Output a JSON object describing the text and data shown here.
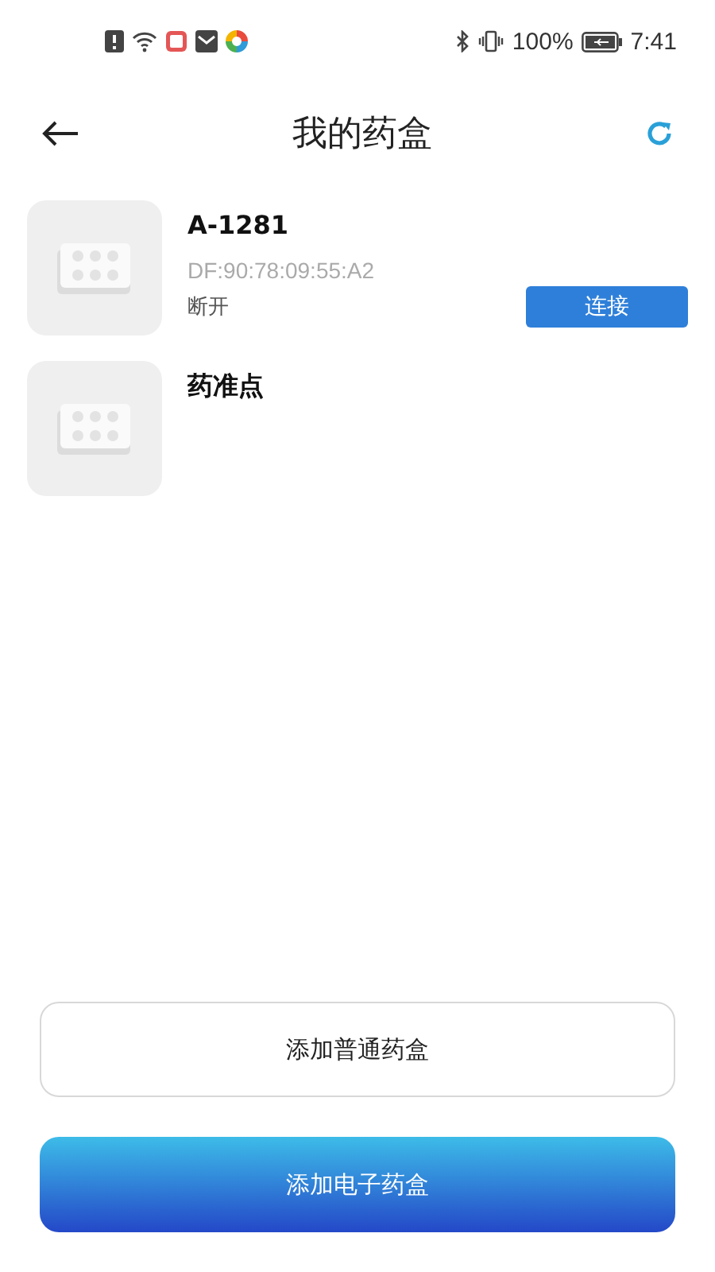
{
  "status_bar": {
    "battery": "100%",
    "time": "7:41"
  },
  "header": {
    "title": "我的药盒"
  },
  "devices": [
    {
      "name": "A-1281",
      "mac": "DF:90:78:09:55:A2",
      "status": "断开",
      "action": "连接"
    },
    {
      "name": "药准点"
    }
  ],
  "buttons": [
    {
      "kind": "outline",
      "label": "添加普通药盒"
    },
    {
      "kind": "primary",
      "label": "添加电子药盒"
    }
  ]
}
